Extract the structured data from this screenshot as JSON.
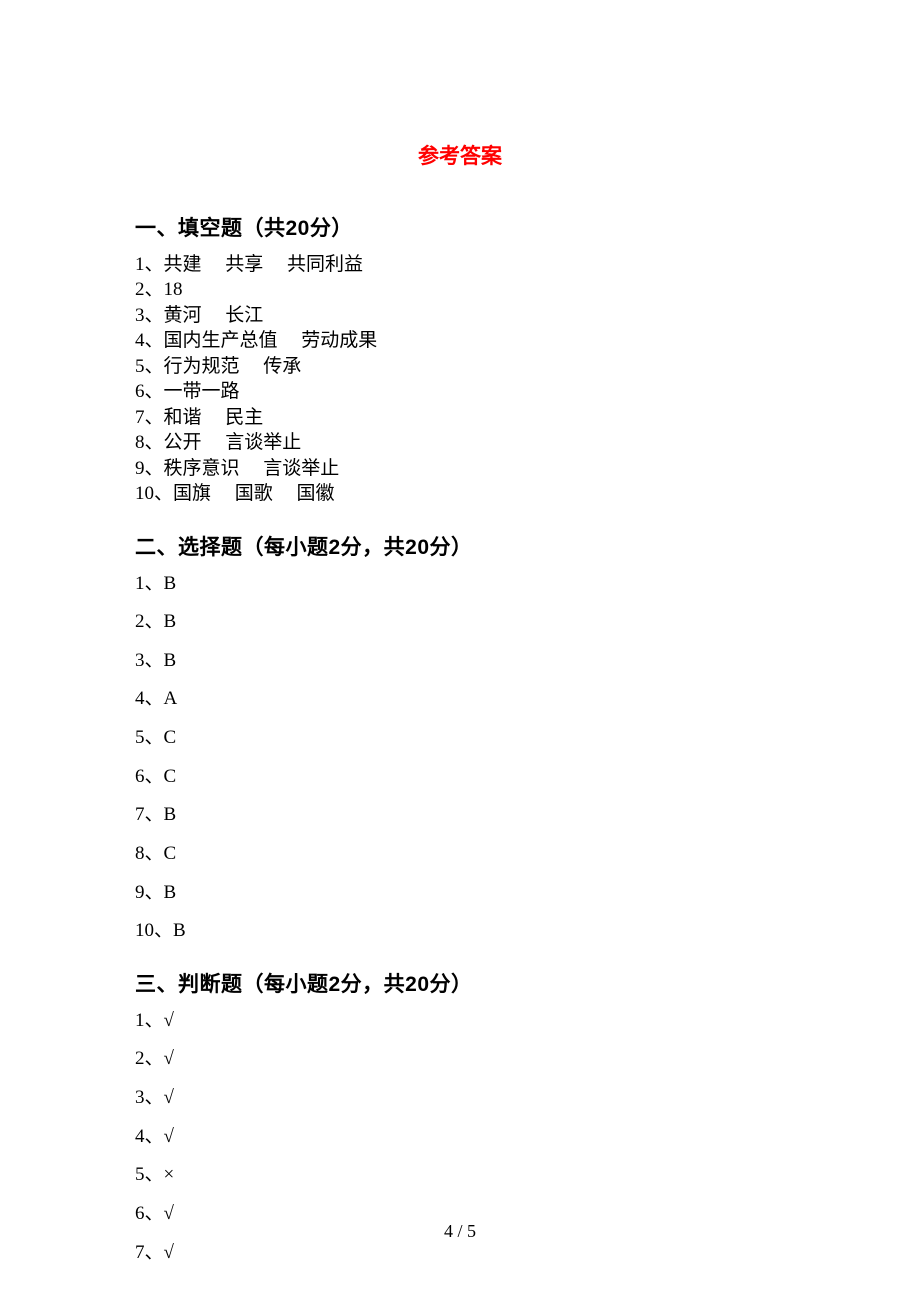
{
  "title": "参考答案",
  "sections": [
    {
      "heading": "一、填空题（共20分）",
      "spaced": false,
      "items": [
        "1、共建     共享     共同利益",
        "2、18",
        "3、黄河     长江",
        "4、国内生产总值     劳动成果",
        "5、行为规范     传承",
        "6、一带一路",
        "7、和谐     民主",
        "8、公开     言谈举止",
        "9、秩序意识     言谈举止",
        "10、国旗     国歌     国徽"
      ]
    },
    {
      "heading": "二、选择题（每小题2分，共20分）",
      "spaced": true,
      "items": [
        "1、B",
        "2、B",
        "3、B",
        "4、A",
        "5、C",
        "6、C",
        "7、B",
        "8、C",
        "9、B",
        "10、B"
      ]
    },
    {
      "heading": "三、判断题（每小题2分，共20分）",
      "spaced": true,
      "items": [
        "1、√",
        "2、√",
        "3、√",
        "4、√",
        "5、×",
        "6、√",
        "7、√"
      ]
    }
  ],
  "pageNumber": "4 / 5"
}
